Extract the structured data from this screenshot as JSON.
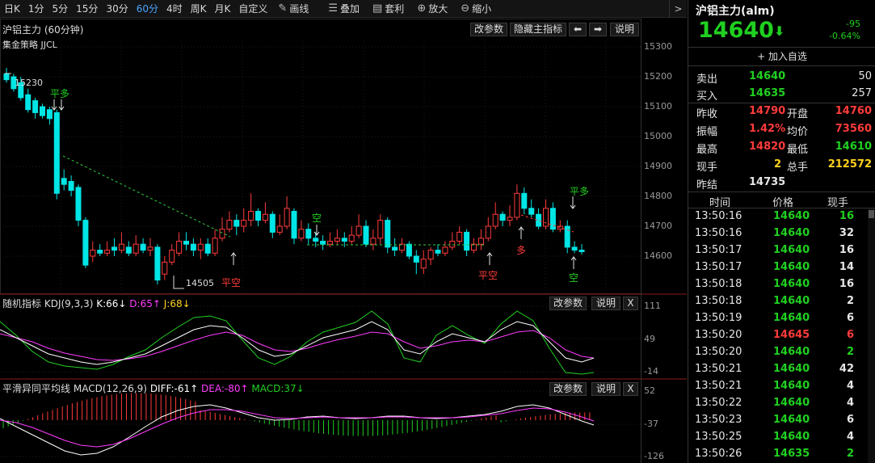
{
  "toolbar": {
    "periods": [
      "日K",
      "1分",
      "5分",
      "15分",
      "30分",
      "60分",
      "4时",
      "周K",
      "月K",
      "自定义"
    ],
    "active_period": "60分",
    "draw_label": "画线",
    "overlay_label": "叠加",
    "arbitrage_label": "套利",
    "zoom_in_label": "放大",
    "zoom_out_label": "缩小",
    "arrow": ">"
  },
  "main_pane": {
    "title": "沪铝主力 (60分钟)",
    "strategy": "集金策略 JJCL",
    "btn_params": "改参数",
    "btn_hide": "隐藏主指标",
    "btn_left": "⬅",
    "btn_right": "➡",
    "btn_help": "说明",
    "high_label": "15230",
    "low_label": "14505",
    "y_ticks": [
      "15300",
      "15200",
      "15100",
      "15000",
      "14900",
      "14800",
      "14700",
      "14600"
    ],
    "signals": {
      "ping_duo_1": "平多",
      "kong_1": "空",
      "ping_kong_1": "平空",
      "ping_kong_2": "平空",
      "duo_1": "多",
      "ping_duo_2": "平多",
      "kong_2": "空"
    }
  },
  "kdj_pane": {
    "name": "随机指标",
    "params": "KDJ(9,3,3)",
    "k": "K:66↓",
    "d": "D:65↑",
    "j": "J:68↓",
    "btn_params": "改参数",
    "btn_help": "说明",
    "btn_close": "X",
    "y_ticks": [
      "111",
      "49",
      "-14"
    ]
  },
  "macd_pane": {
    "name": "平滑异同平均线",
    "params": "MACD(12,26,9)",
    "diff": "DIFF:-61↑",
    "dea": "DEA:-80↑",
    "macd": "MACD:37↓",
    "btn_params": "改参数",
    "btn_help": "说明",
    "btn_close": "X",
    "y_ticks": [
      "52",
      "-37",
      "-126"
    ]
  },
  "quote": {
    "title": "沪铝主力(alm)",
    "price": "14640",
    "arrow": "⬇",
    "change": "-95",
    "change_pct": "-0.64%",
    "add_watch": "+ 加入自选",
    "sell_label": "卖出",
    "sell_price": "14640",
    "sell_vol": "50",
    "buy_label": "买入",
    "buy_price": "14635",
    "buy_vol": "257",
    "prev_close_label": "昨收",
    "prev_close": "14790",
    "open_label": "开盘",
    "open": "14760",
    "amp_label": "振幅",
    "amp": "1.42%",
    "avg_label": "均价",
    "avg": "73560",
    "high_label": "最高",
    "high": "14820",
    "low_label": "最低",
    "low": "14610",
    "cur_label": "现手",
    "cur": "2",
    "total_label": "总手",
    "total": "212572",
    "settle_label": "昨结",
    "settle": "14735"
  },
  "ticks": {
    "headers": [
      "时间",
      "价格",
      "现手"
    ],
    "rows": [
      [
        "13:50:16",
        "14640",
        "16",
        "g"
      ],
      [
        "13:50:16",
        "14640",
        "32",
        "w"
      ],
      [
        "13:50:17",
        "14640",
        "16",
        "w"
      ],
      [
        "13:50:17",
        "14640",
        "14",
        "w"
      ],
      [
        "13:50:18",
        "14640",
        "16",
        "w"
      ],
      [
        "13:50:18",
        "14640",
        "2",
        "w"
      ],
      [
        "13:50:19",
        "14640",
        "6",
        "w"
      ],
      [
        "13:50:20",
        "14645",
        "6",
        "r"
      ],
      [
        "13:50:20",
        "14640",
        "2",
        "g"
      ],
      [
        "13:50:21",
        "14640",
        "42",
        "w"
      ],
      [
        "13:50:21",
        "14640",
        "4",
        "w"
      ],
      [
        "13:50:22",
        "14640",
        "4",
        "w"
      ],
      [
        "13:50:23",
        "14640",
        "6",
        "w"
      ],
      [
        "13:50:25",
        "14640",
        "4",
        "w"
      ],
      [
        "13:50:26",
        "14635",
        "2",
        "g"
      ]
    ]
  },
  "colors": {
    "up": "#ff3b3b",
    "down": "#00e5e5",
    "green": "#20d020",
    "yellow": "#ffd21e",
    "magenta": "#ff3cff",
    "dashed": "#2ecc40"
  }
}
